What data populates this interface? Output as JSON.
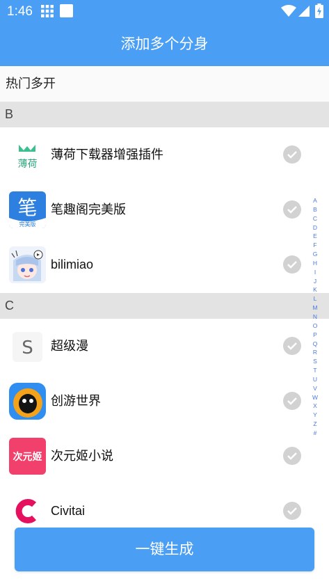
{
  "status_bar": {
    "time": "1:46"
  },
  "header": {
    "title": "添加多个分身"
  },
  "hot_label": "热门多开",
  "sections": [
    {
      "letter": "B",
      "apps": [
        {
          "name": "薄荷下载器增强插件",
          "icon": "mint-leaf-icon",
          "icon_text": "薄荷"
        },
        {
          "name": "笔趣阁完美版",
          "icon": "biquge-icon",
          "icon_text": "笔",
          "icon_subtext": "完美版"
        },
        {
          "name": "bilimiao",
          "icon": "bilimiao-anime-icon"
        }
      ]
    },
    {
      "letter": "C",
      "apps": [
        {
          "name": "超级漫",
          "icon": "letter-s-icon",
          "icon_text": "S"
        },
        {
          "name": "创游世界",
          "icon": "chuangyou-icon"
        },
        {
          "name": "次元姬小说",
          "icon": "ciyuanji-icon",
          "icon_text": "次元姬"
        },
        {
          "name": "Civitai",
          "icon": "civitai-c-icon"
        }
      ]
    }
  ],
  "alphabet": [
    "A",
    "B",
    "C",
    "D",
    "E",
    "F",
    "G",
    "H",
    "I",
    "J",
    "K",
    "L",
    "M",
    "N",
    "O",
    "P",
    "Q",
    "R",
    "S",
    "T",
    "U",
    "V",
    "W",
    "X",
    "Y",
    "Z",
    "#"
  ],
  "generate_button": "一键生成",
  "colors": {
    "primary": "#4a9ff5",
    "section_bg": "#e3e3e3",
    "check_gray": "#d2d2d2",
    "index_blue": "#4a7bd8"
  }
}
